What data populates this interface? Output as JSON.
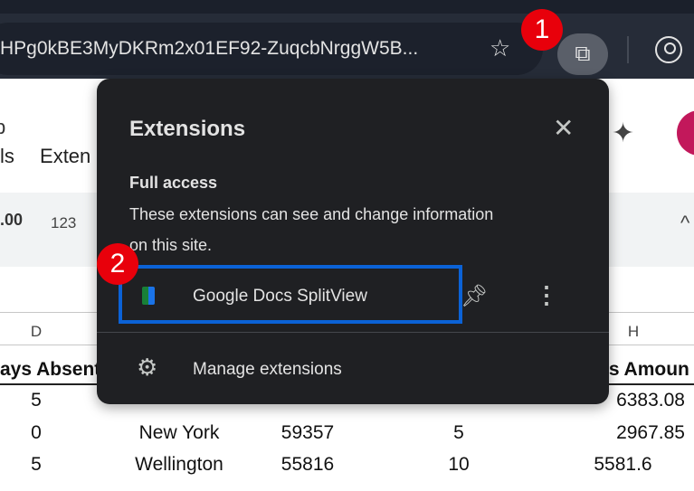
{
  "browser": {
    "url": "HPg0kBE3MyDKRm2x01EF92-ZuqcbNrggW5B...",
    "bookmark_icon": "star-icon",
    "extensions_icon": "puzzle-icon",
    "profile_icon": "profile-icon"
  },
  "doc": {
    "menu_partial_1": "ls",
    "menu_partial_2": "Exten",
    "title_partial": "p",
    "format_partial": ".00",
    "number_format": "123",
    "collapse": "^"
  },
  "sheet": {
    "columns": [
      "D",
      "H"
    ],
    "headers": {
      "d": "ays Absent",
      "h": "us Amoun"
    },
    "rows": [
      {
        "d": "5",
        "e": "",
        "f": "",
        "g": "",
        "h": "6383.08"
      },
      {
        "d": "0",
        "e": "New York",
        "f": "59357",
        "g": "5",
        "h": "2967.85"
      },
      {
        "d": "5",
        "e": "Wellington",
        "f": "55816",
        "g": "10",
        "h": "5581.6"
      }
    ]
  },
  "popup": {
    "title": "Extensions",
    "section": "Full access",
    "description_line1": "These extensions can see and change information",
    "description_line2": "on this site.",
    "extension_name": "Google Docs SplitView",
    "manage": "Manage extensions"
  },
  "annotations": {
    "badge1": "1",
    "badge2": "2",
    "badge_color": "#e8000b",
    "highlight_color": "#0b62d6"
  }
}
